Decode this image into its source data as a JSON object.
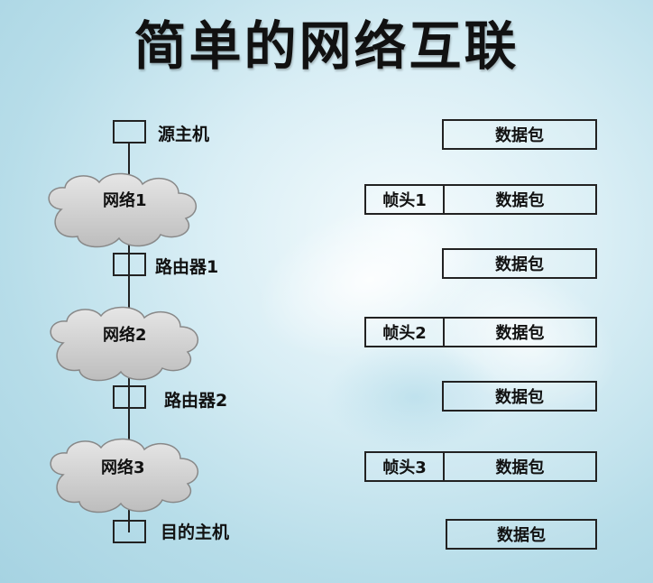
{
  "title": "简单的网络互联",
  "left_column": {
    "source_host": "源主机",
    "network1": "网络1",
    "router1": "路由器1",
    "network2": "网络2",
    "router2": "路由器2",
    "network3": "网络3",
    "dest_host": "目的主机"
  },
  "packets": [
    {
      "header": "",
      "payload": "数据包"
    },
    {
      "header": "帧头1",
      "payload": "数据包"
    },
    {
      "header": "",
      "payload": "数据包"
    },
    {
      "header": "帧头2",
      "payload": "数据包"
    },
    {
      "header": "",
      "payload": "数据包"
    },
    {
      "header": "帧头3",
      "payload": "数据包"
    },
    {
      "header": "",
      "payload": "数据包"
    }
  ]
}
